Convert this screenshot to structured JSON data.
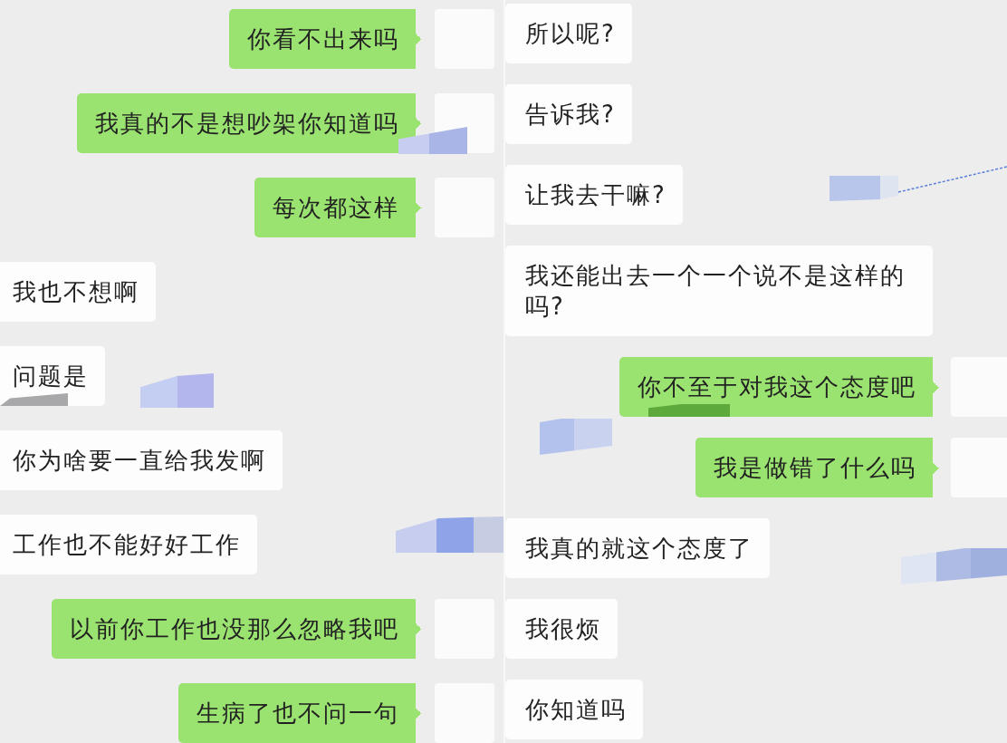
{
  "panels": [
    {
      "messages": [
        {
          "kind": "sent",
          "text": "你看不出来吗"
        },
        {
          "kind": "sent",
          "text": "我真的不是想吵架你知道吗"
        },
        {
          "kind": "sent",
          "text": "每次都这样"
        },
        {
          "kind": "received",
          "text": "我也不想啊"
        },
        {
          "kind": "received",
          "text": "问题是"
        },
        {
          "kind": "received",
          "text": "你为啥要一直给我发啊"
        },
        {
          "kind": "received",
          "text": "工作也不能好好工作"
        },
        {
          "kind": "sent",
          "text": "以前你工作也没那么忽略我吧"
        },
        {
          "kind": "sent",
          "text": "生病了也不问一句"
        }
      ]
    },
    {
      "messages": [
        {
          "kind": "received",
          "text": "所以呢?"
        },
        {
          "kind": "received",
          "text": "告诉我?"
        },
        {
          "kind": "received",
          "text": "让我去干嘛?"
        },
        {
          "kind": "received",
          "text": "我还能出去一个一个说不是这样的吗?"
        },
        {
          "kind": "sent",
          "text": "你不至于对我这个态度吧"
        },
        {
          "kind": "sent",
          "text": "我是做错了什么吗"
        },
        {
          "kind": "received",
          "text": "我真的就这个态度了"
        },
        {
          "kind": "received",
          "text": "我很烦"
        },
        {
          "kind": "received",
          "text": "你知道吗"
        }
      ]
    }
  ]
}
